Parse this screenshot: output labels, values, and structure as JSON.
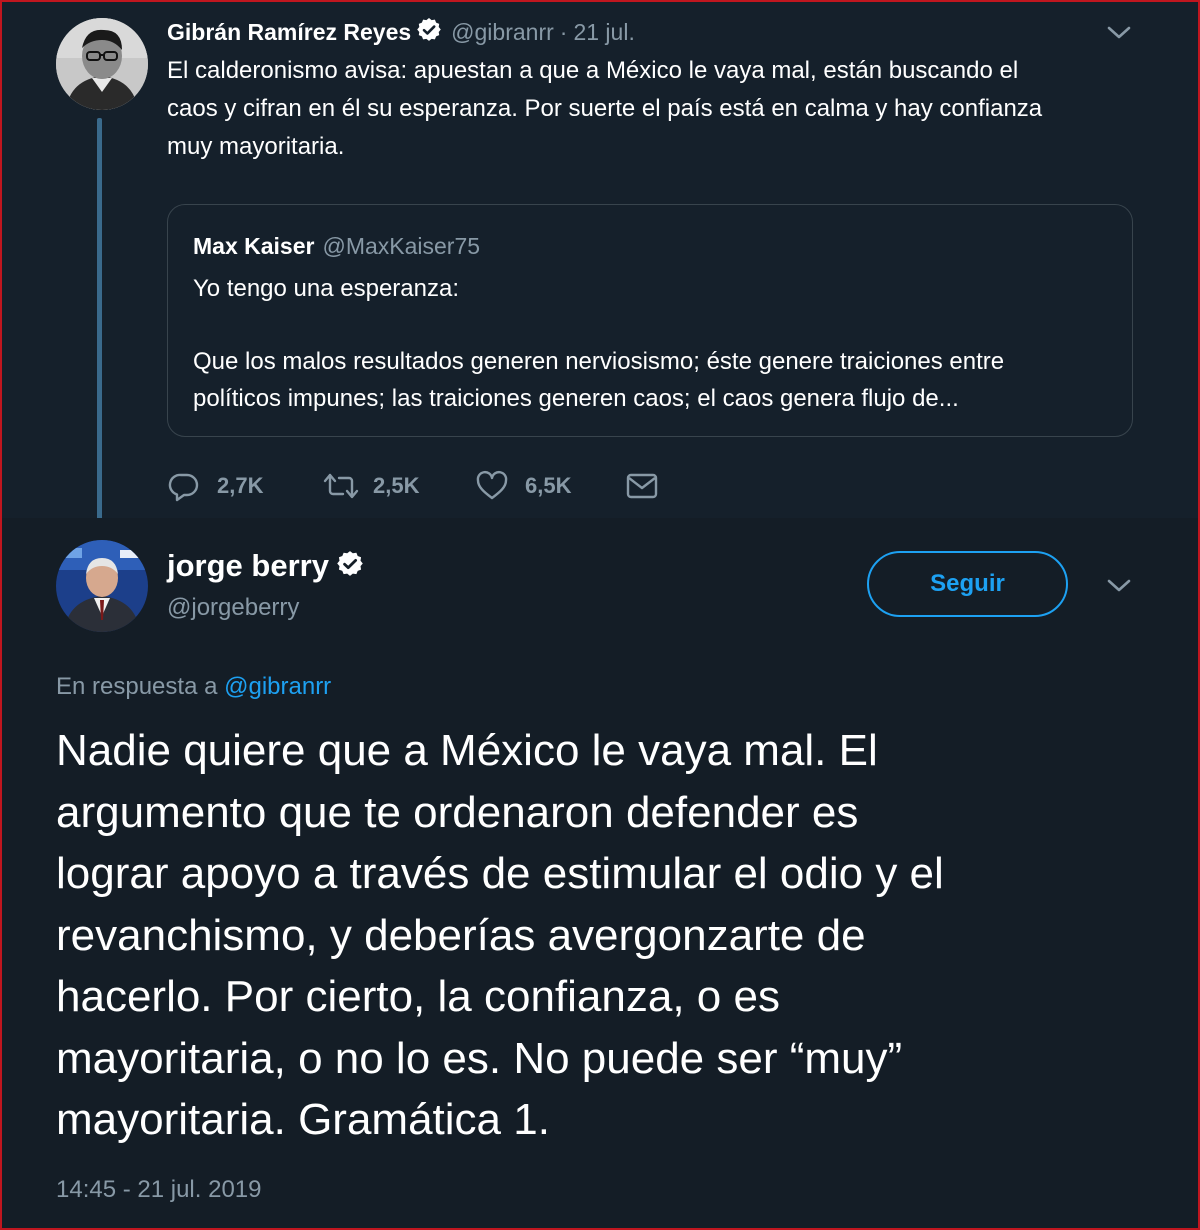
{
  "colors": {
    "border": "#c0161f",
    "background": "#15202b",
    "text_primary": "#ffffff",
    "text_secondary": "#8899a6",
    "accent": "#1da1f2",
    "thread_line": "#3a6a8c"
  },
  "parent_tweet": {
    "author_name": "Gibrán Ramírez Reyes",
    "handle": "@gibranrr",
    "separator": "·",
    "date": "21 jul.",
    "verified_icon": "verified-badge-icon",
    "text_lines": [
      "El calderonismo avisa: apuestan a que a México le vaya mal, están buscando el",
      "caos y cifran en él su esperanza. Por suerte el país está en calma y hay confianza",
      "muy mayoritaria."
    ],
    "quoted": {
      "author_name": "Max Kaiser",
      "handle": "@MaxKaiser75",
      "text_lines": [
        "Yo tengo una esperanza:",
        "Que los malos resultados generen nerviosismo; éste genere traiciones entre",
        "políticos impunes; las traiciones generen caos; el caos genera flujo de..."
      ]
    },
    "actions": {
      "replies": "2,7K",
      "retweets": "2,5K",
      "likes": "6,5K"
    }
  },
  "focal_tweet": {
    "author_name": "jorge berry",
    "handle": "@jorgeberry",
    "follow_label": "Seguir",
    "reply_prefix": "En respuesta a",
    "reply_to": "@gibranrr",
    "text_lines": [
      "Nadie quiere que a México le vaya mal. El",
      "argumento que te ordenaron defender es",
      "lograr apoyo a través de estimular el odio y el",
      "revanchismo, y deberías avergonzarte de",
      "hacerlo. Por cierto, la confianza, o es",
      "mayoritaria, o no lo es. No puede ser “muy”",
      "mayoritaria. Gramática 1."
    ],
    "timestamp": "14:45 - 21 jul. 2019"
  }
}
